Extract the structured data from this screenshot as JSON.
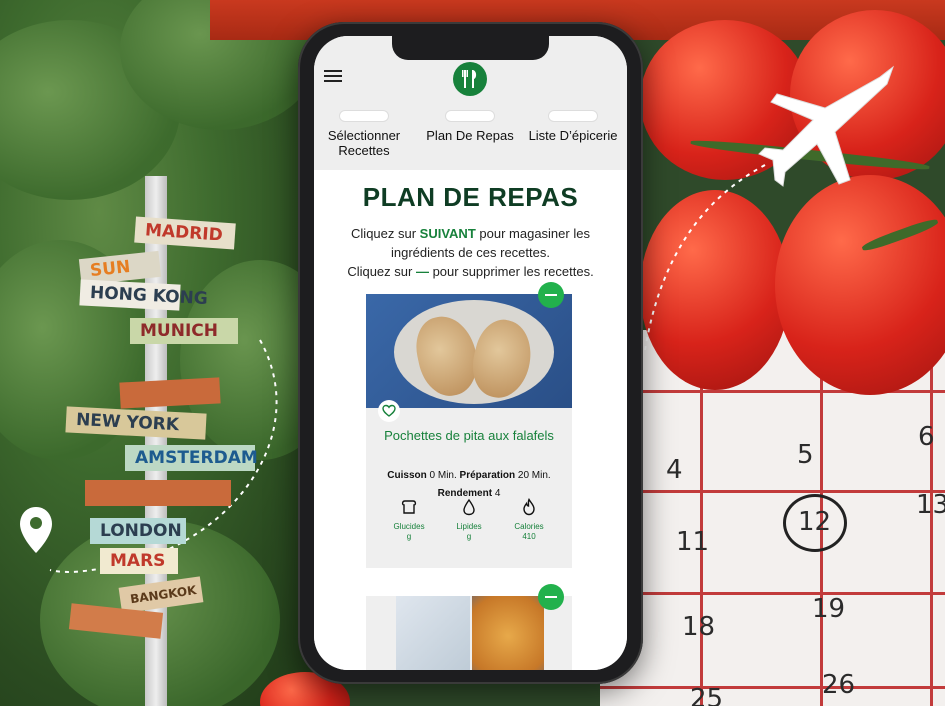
{
  "background": {
    "signs": [
      "MADRID",
      "SUN",
      "HONG KONG",
      "MUNICH",
      "NEW YORK",
      "AMSTERDAM",
      "LONDON",
      "MARS",
      "BANGKOK"
    ],
    "calendar_numbers": [
      "4",
      "5",
      "6",
      "11",
      "12",
      "13",
      "18",
      "19",
      "25",
      "26"
    ]
  },
  "app": {
    "tabs": [
      {
        "label": "Sélectionner Recettes"
      },
      {
        "label": "Plan De Repas"
      },
      {
        "label": "Liste D’épicerie"
      }
    ],
    "page_title": "PLAN DE REPAS",
    "intro": {
      "line1_pre": "Cliquez sur ",
      "line1_bold": "SUIVANT",
      "line1_post": " pour magasiner les ingrédients de ces recettes.",
      "line2_pre": "Cliquez sur ",
      "line2_symbol": "—",
      "line2_post": " pour supprimer les recettes."
    },
    "recipes": [
      {
        "name": "Pochettes de pita aux falafels",
        "cuisson_label": "Cuisson",
        "cuisson_value": "0 Min.",
        "prep_label": "Préparation",
        "prep_value": "20 Min.",
        "rendement_label": "Rendement",
        "rendement_value": "4",
        "nutrition": [
          {
            "icon": "bread-icon",
            "label": "Glucides",
            "value": "g"
          },
          {
            "icon": "drop-icon",
            "label": "Lipides",
            "value": "g"
          },
          {
            "icon": "flame-icon",
            "label": "Calories",
            "value": "410"
          }
        ]
      }
    ]
  },
  "colors": {
    "brand_green": "#17813b",
    "remove_green": "#22b14c",
    "title_green": "#0f3d24"
  }
}
